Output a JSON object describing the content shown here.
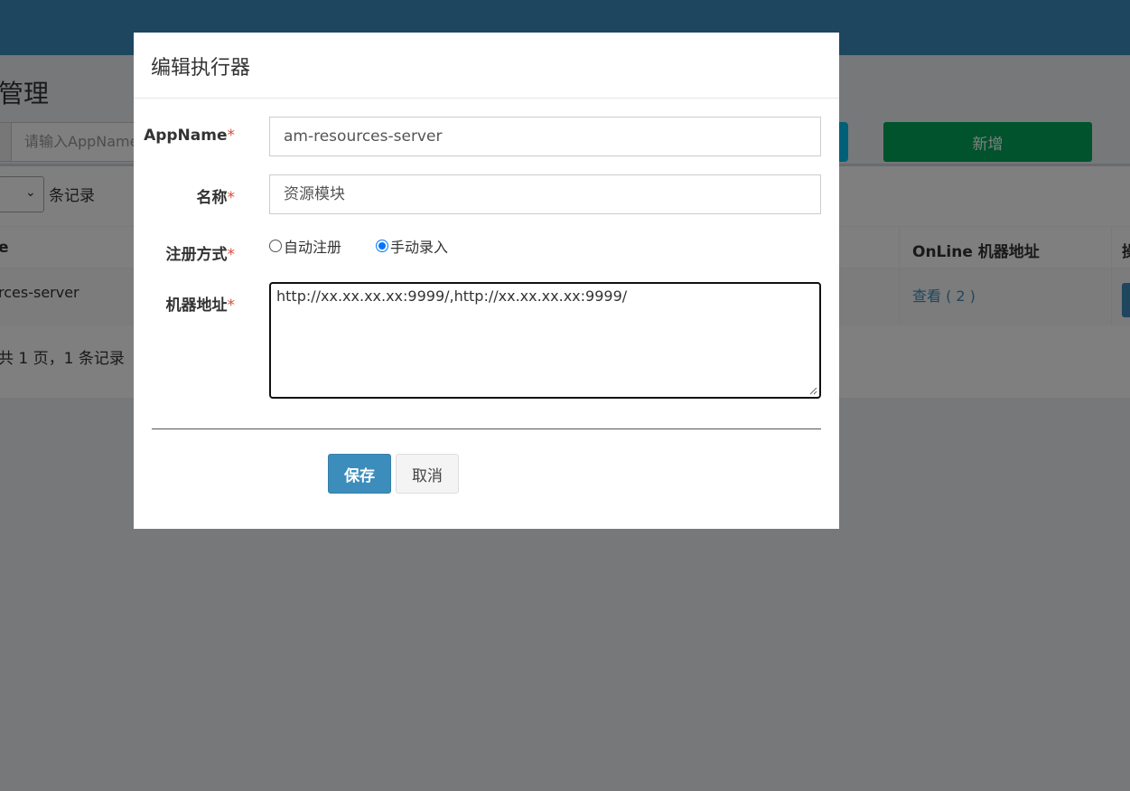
{
  "background": {
    "page_title": "管理",
    "search_placeholder": "请输入AppName",
    "add_button": "新增",
    "length_label": "条记录",
    "table": {
      "headers": [
        "e",
        "OnLine 机器地址",
        "操"
      ],
      "row": {
        "appname": "rces-server",
        "online_link": "查看 ( 2 )"
      }
    },
    "info": "共 1 页，1 条记录"
  },
  "modal": {
    "title": "编辑执行器",
    "fields": {
      "appname": {
        "label": "AppName",
        "value": "am-resources-server"
      },
      "name": {
        "label": "名称",
        "value": "资源模块"
      },
      "register": {
        "label": "注册方式",
        "options": [
          "自动注册",
          "手动录入"
        ],
        "selected": "手动录入"
      },
      "address": {
        "label": "机器地址",
        "value": "http://xx.xx.xx.xx:9999/,http://xx.xx.xx.xx:9999/"
      }
    },
    "required_mark": "*",
    "save_button": "保存",
    "cancel_button": "取消"
  },
  "colors": {
    "header": "#3c8dbc",
    "success": "#00a65a",
    "info": "#00c0ef",
    "required": "#dd4b39"
  }
}
